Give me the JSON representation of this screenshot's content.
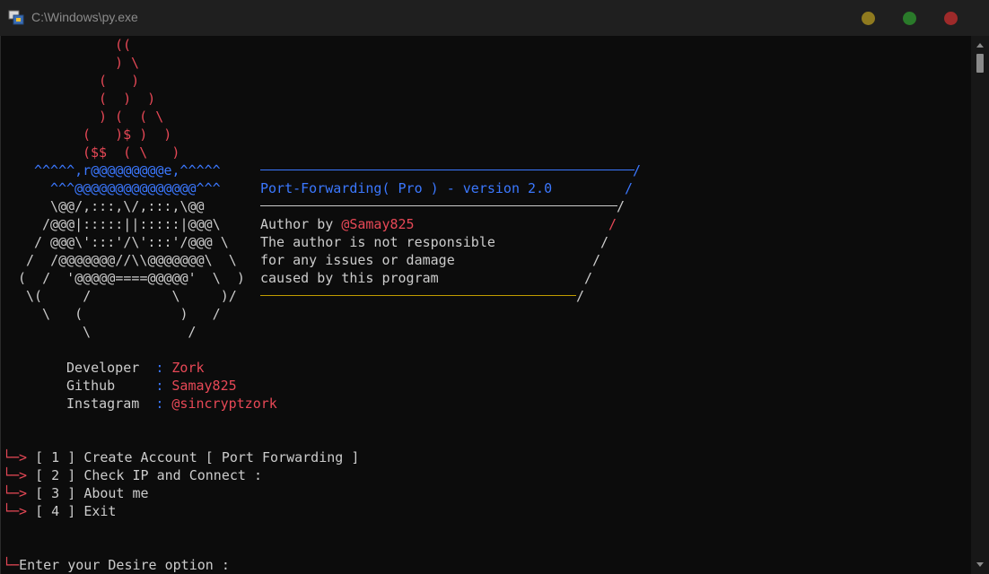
{
  "window": {
    "title": "C:\\Windows\\py.exe"
  },
  "colors": {
    "red": "#e74856",
    "blue": "#3b78ff",
    "yellow": "#c19c00",
    "text": "#cccccc",
    "background": "#0c0c0c"
  },
  "art": {
    "fire": [
      "((",
      ") \\",
      "(   )",
      "(  )  )",
      ") (  ( \\",
      "(   )$ )  )",
      "($$  ( \\   )"
    ],
    "skull": [
      "^^^^^,r@@@@@@@@@e,^^^^^",
      "^^^@@@@@@@@@@@@@@@^^^",
      "\\@@/,:::,\\/,:::,\\@@",
      "/@@@|:::::||:::::|@@@\\",
      "/ @@@\\':::'/\\':::'/@@@ \\",
      "/  /@@@@@@@//\\\\@@@@@@@\\  \\",
      "(  /  '@@@@@====@@@@@'  \\  )",
      "\\(     /          \\     )/",
      "\\   (            )   /",
      "\\            /"
    ]
  },
  "banner": {
    "title": "Port-Forwarding( Pro ) - version 2.0",
    "author_prefix": "Author by ",
    "author_handle": "@Samay825",
    "disclaimer": [
      "The author is not responsible",
      "for any issues or damage",
      "caused by this program"
    ]
  },
  "info": [
    {
      "label": "Developer  ",
      "sep": ": ",
      "value": "Zork"
    },
    {
      "label": "Github     ",
      "sep": ": ",
      "value": "Samay825"
    },
    {
      "label": "Instagram  ",
      "sep": ": ",
      "value": "@sincryptzork"
    }
  ],
  "menu": {
    "arrow": "└─>",
    "items": [
      {
        "num": "[ 1 ]",
        "label": "Create Account [ Port Forwarding ]"
      },
      {
        "num": "[ 2 ]",
        "label": "Check IP and Connect :"
      },
      {
        "num": "[ 3 ]",
        "label": "About me"
      },
      {
        "num": "[ 4 ]",
        "label": "Exit"
      }
    ]
  },
  "prompt": {
    "prefix": "└─",
    "text": "Enter your Desire option :"
  }
}
